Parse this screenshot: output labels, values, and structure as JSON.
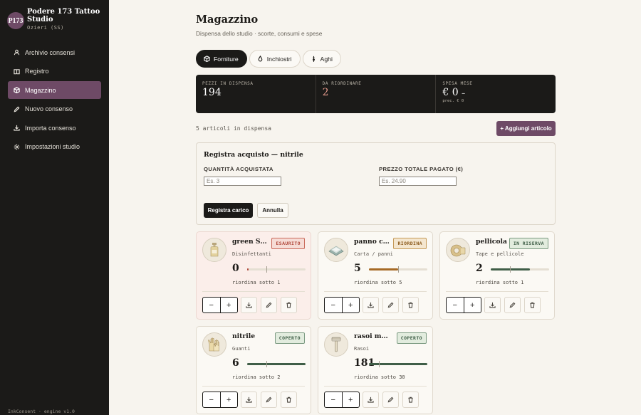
{
  "sidebar": {
    "logo": "P173",
    "studio_name": "Podere 173 Tattoo Studio",
    "studio_location": "Ozieri (SS)",
    "items": [
      {
        "label": "Archivio consensi",
        "icon": "users-icon"
      },
      {
        "label": "Registro",
        "icon": "book-icon"
      },
      {
        "label": "Magazzino",
        "icon": "box-icon",
        "active": true
      },
      {
        "label": "Nuovo consenso",
        "icon": "pen-icon"
      },
      {
        "label": "Importa consenso",
        "icon": "download-icon"
      },
      {
        "label": "Impostazioni studio",
        "icon": "gear-icon"
      }
    ],
    "version": "InkConsent · engine v1.0"
  },
  "page": {
    "title": "Magazzino",
    "subtitle": "Dispensa dello studio · scorte, consumi e spese"
  },
  "tabs": [
    {
      "label": "Forniture",
      "icon": "box-icon",
      "active": true
    },
    {
      "label": "Inchiostri",
      "icon": "drop-icon"
    },
    {
      "label": "Aghi",
      "icon": "needle-icon"
    }
  ],
  "stats": {
    "pezzi_label": "Pezzi in dispensa",
    "pezzi_value": "194",
    "riordinare_label": "Da riordinare",
    "riordinare_value": "2",
    "spesa_label": "Spesa mese",
    "spesa_value": "€ 0",
    "spesa_dash": "–",
    "spesa_sub": "prec. € 0"
  },
  "list": {
    "count_text": "5 articoli in dispensa",
    "add_label": "+ Aggiungi articolo"
  },
  "purchase": {
    "title": "Registra acquisto — nitrile",
    "qty_label": "QUANTITÀ ACQUISTATA",
    "qty_placeholder": "Es. 3",
    "price_label": "PREZZO TOTALE PAGATO (€)",
    "price_placeholder": "Es. 24.90",
    "submit_label": "Registra carico",
    "cancel_label": "Annulla"
  },
  "colors": {
    "accent": "#6e4a66",
    "dark": "#1b1a18",
    "danger": "#b0473a",
    "warning": "#a66a26",
    "ok": "#3f5e47"
  },
  "cards": [
    {
      "name": "green Soap",
      "category": "Disinfettanti",
      "badge": "Esaurito",
      "status": "esaurito",
      "qty": "0",
      "reorder": "riordina sotto 1",
      "level": 0.03,
      "threshold": 0.33,
      "icon": "soap-bottle-icon"
    },
    {
      "name": "panno carta",
      "category": "Carta / panni",
      "badge": "Riordina",
      "status": "riordina",
      "qty": "5",
      "reorder": "riordina sotto 5",
      "level": 0.5,
      "threshold": 0.5,
      "icon": "paper-towel-icon"
    },
    {
      "name": "pellicola",
      "category": "Tape e pellicole",
      "badge": "In riserva",
      "status": "riserva",
      "qty": "2",
      "reorder": "riordina sotto 1",
      "level": 0.67,
      "threshold": 0.33,
      "icon": "tape-icon"
    },
    {
      "name": "nitrile",
      "category": "Guanti",
      "badge": "Coperto",
      "status": "coperto",
      "qty": "6",
      "reorder": "riordina sotto 2",
      "level": 1.0,
      "threshold": 0.33,
      "icon": "gloves-icon"
    },
    {
      "name": "rasoi monouso",
      "category": "Rasoi",
      "badge": "Coperto",
      "status": "coperto",
      "qty": "181",
      "reorder": "riordina sotto 30",
      "level": 1.0,
      "threshold": 0.17,
      "icon": "razor-icon"
    }
  ]
}
